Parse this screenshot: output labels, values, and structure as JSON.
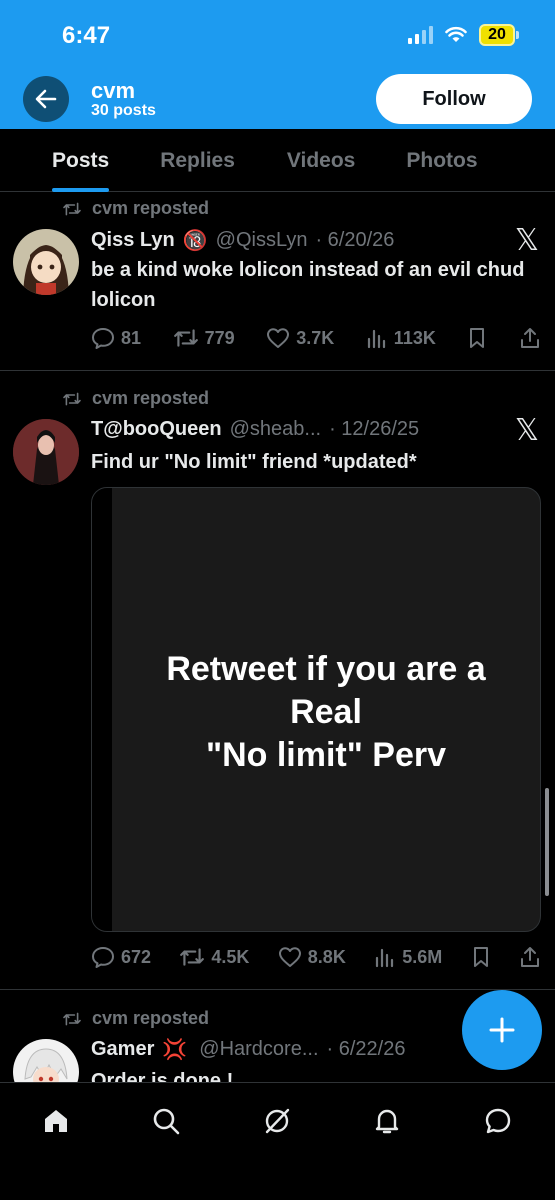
{
  "status_bar": {
    "time": "6:47",
    "battery": "20"
  },
  "header": {
    "name": "cvm",
    "posts": "30 posts",
    "follow_label": "Follow"
  },
  "tabs": [
    {
      "label": "Posts",
      "active": true
    },
    {
      "label": "Replies"
    },
    {
      "label": "Videos"
    },
    {
      "label": "Photos"
    }
  ],
  "tweets": [
    {
      "repost_label": "cvm reposted",
      "display_name": "Qiss Lyn",
      "badge": "🔞",
      "handle": "@QissLyn",
      "date": "· 6/20/26",
      "text": "be a kind woke lolicon instead of an evil chud lolicon",
      "replies": "81",
      "reposts": "779",
      "likes": "3.7K",
      "views": "113K"
    },
    {
      "repost_label": "cvm reposted",
      "display_name": "T@booQueen",
      "handle": "@sheab...",
      "date": "· 12/26/25",
      "text": "Find ur \"No limit\" friend *updated*",
      "media_text_lines": [
        "Retweet if you are a",
        "Real",
        "\"No limit\" Perv"
      ],
      "replies": "672",
      "reposts": "4.5K",
      "likes": "8.8K",
      "views": "5.6M"
    },
    {
      "repost_label": "cvm reposted",
      "display_name": "Gamer",
      "badge": "💢",
      "handle": "@Hardcore...",
      "date": "· 6/22/26",
      "text": "Order is done !"
    }
  ],
  "colors": {
    "accent": "#1d9bf0",
    "background": "#000000",
    "muted": "#71767b",
    "text": "#e7e9ea"
  },
  "nav_icons": [
    "home-icon",
    "search-icon",
    "grok-icon",
    "notifications-icon",
    "messages-icon"
  ]
}
